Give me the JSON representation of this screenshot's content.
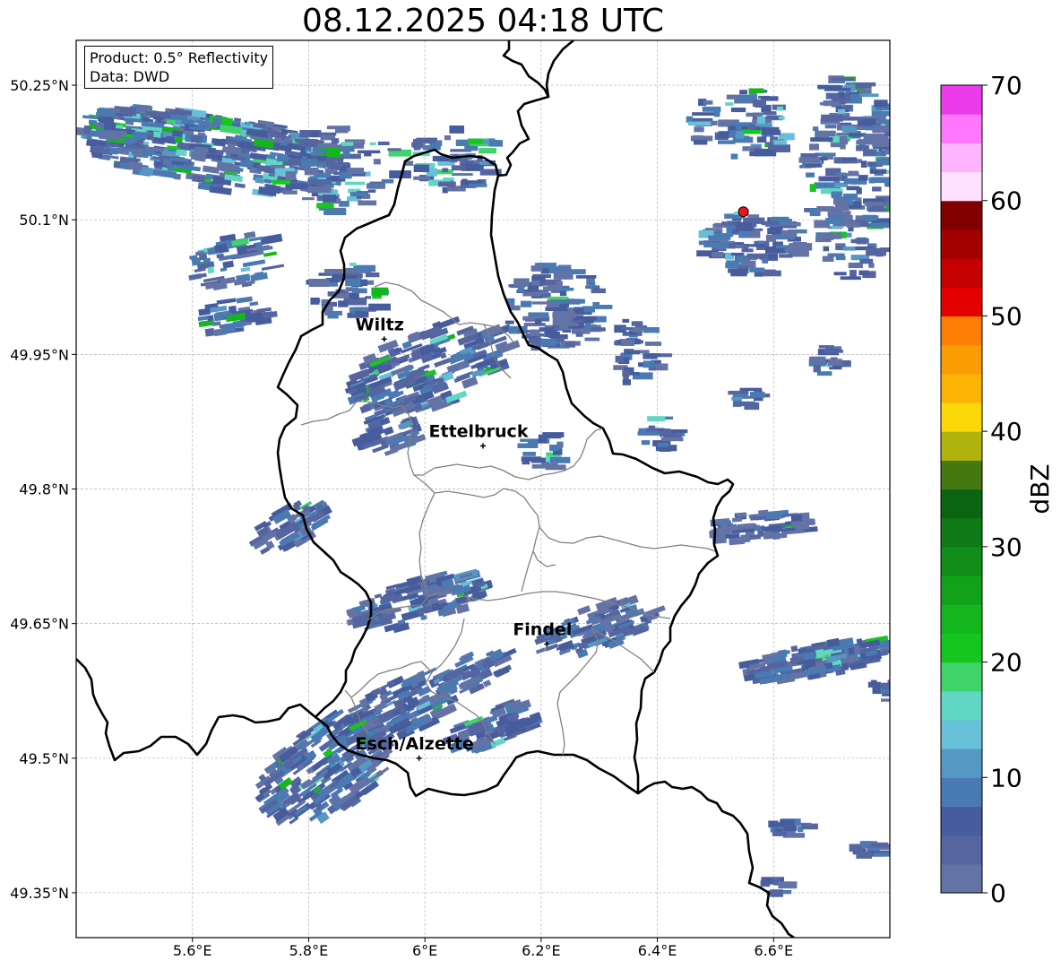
{
  "title": "08.12.2025 04:18 UTC",
  "info": {
    "product": "Product: 0.5° Reflectivity",
    "source": "Data: DWD"
  },
  "map": {
    "lon_range": [
      5.4,
      6.8
    ],
    "lat_range": [
      49.3,
      50.3
    ],
    "grid": true,
    "lon_ticks": [
      "5.6°E",
      "5.8°E",
      "6°E",
      "6.2°E",
      "6.4°E",
      "6.6°E"
    ],
    "lat_ticks": [
      "50.25°N",
      "50.1°N",
      "49.95°N",
      "49.8°N",
      "49.65°N",
      "49.5°N",
      "49.35°N"
    ],
    "radar_site": {
      "lon": 6.548,
      "lat": 50.109,
      "marker_color": "#e8141e"
    },
    "cities": [
      {
        "name": "Wiltz",
        "lon": 5.93,
        "lat": 49.967
      },
      {
        "name": "Ettelbruck",
        "lon": 6.1,
        "lat": 49.848
      },
      {
        "name": "Findel",
        "lon": 6.21,
        "lat": 49.627
      },
      {
        "name": "Esch/Alzette",
        "lon": 5.99,
        "lat": 49.5
      }
    ]
  },
  "colorbar": {
    "label": "dBZ",
    "range": [
      0,
      70
    ],
    "ticks": [
      "0",
      "10",
      "20",
      "30",
      "40",
      "50",
      "60",
      "70"
    ],
    "colors": [
      "#6473a5",
      "#5565a0",
      "#465c9d",
      "#4a7ab2",
      "#5797c3",
      "#68bfd8",
      "#61d6c3",
      "#3fd36a",
      "#14c61e",
      "#13b61c",
      "#12a21a",
      "#118e19",
      "#0e7a16",
      "#0a6412",
      "#457810",
      "#b0b20e",
      "#fdd808",
      "#fcb404",
      "#fc9c04",
      "#fc7e04",
      "#e40000",
      "#c40000",
      "#a40000",
      "#800000",
      "#ffe0ff",
      "#ffb4ff",
      "#ff78ff",
      "#eb3ceb"
    ]
  }
}
